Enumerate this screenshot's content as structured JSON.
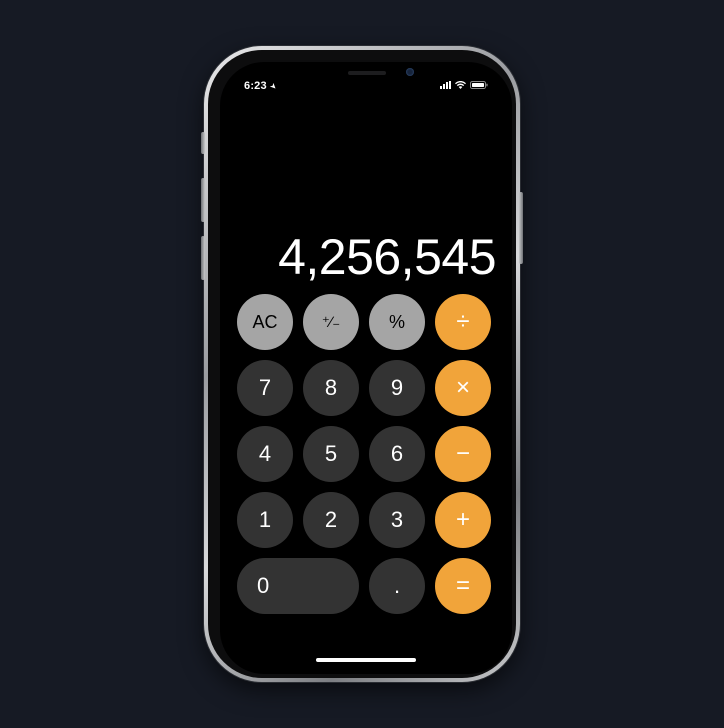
{
  "status_bar": {
    "time": "6:23",
    "location_icon": "location-arrow-icon",
    "signal_icon": "cellular-signal-icon",
    "wifi_icon": "wifi-icon",
    "battery_icon": "battery-icon"
  },
  "display": {
    "value": "4,256,545"
  },
  "keypad": {
    "ac": "AC",
    "plus_minus": "⁺∕₋",
    "percent": "%",
    "divide": "÷",
    "seven": "7",
    "eight": "8",
    "nine": "9",
    "multiply": "×",
    "four": "4",
    "five": "5",
    "six": "6",
    "minus": "−",
    "one": "1",
    "two": "2",
    "three": "3",
    "plus": "+",
    "zero": "0",
    "decimal": ".",
    "equals": "="
  },
  "colors": {
    "background": "#161a24",
    "function_key": "#a5a5a5",
    "number_key": "#333333",
    "operator_key": "#f1a43a",
    "screen": "#000000"
  }
}
